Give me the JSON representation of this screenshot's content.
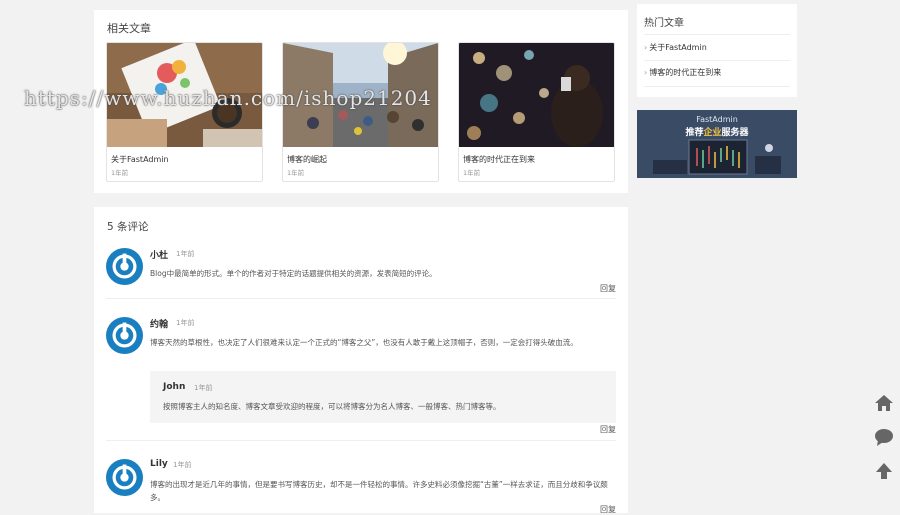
{
  "related": {
    "title": "相关文章",
    "articles": [
      {
        "title": "关于FastAdmin",
        "time": "1年前"
      },
      {
        "title": "博客的崛起",
        "time": "1年前"
      },
      {
        "title": "博客的时代正在到来",
        "time": "1年前"
      }
    ]
  },
  "hot": {
    "title": "热门文章",
    "items": [
      {
        "chevron": "›",
        "label": "关于FastAdmin"
      },
      {
        "chevron": "›",
        "label": "博客的时代正在到来"
      }
    ]
  },
  "banner": {
    "line1": "FastAdmin",
    "line2_a": "推荐",
    "line2_b": "企业",
    "line2_c": "服务器"
  },
  "comments": {
    "title": "5 条评论",
    "reply_label": "回复",
    "items": [
      {
        "name": "小杜",
        "time": "1年前",
        "text": "Blog中最简单的形式。单个的作者对于特定的话题提供相关的资源，发表简短的评论。"
      },
      {
        "name": "约翰",
        "time": "1年前",
        "text": "博客天然的草根性，也决定了人们很难来认定一个正式的“博客之父”，也没有人敢于戴上这顶帽子，否则，一定会打得头破血流。",
        "reply": {
          "name": "John",
          "time": "1年前",
          "text": "按照博客主人的知名度、博客文章受欢迎的程度，可以将博客分为名人博客、一般博客、热门博客等。"
        }
      },
      {
        "name": "Lily",
        "time": "1年前",
        "text": "博客的出现才是近几年的事情，但是要书写博客历史，却不是一件轻松的事情。许多史料必须像挖掘“古董”一样去求证，而且分歧和争议颇多。"
      }
    ]
  },
  "watermark": "https://www.huzhan.com/ishop21204",
  "colors": {
    "accent": "#1a7fc1",
    "banner_bg": "#3a4b66",
    "highlight": "#f6c342"
  },
  "icons": [
    "home-icon",
    "comment-icon",
    "arrow-up-icon"
  ]
}
